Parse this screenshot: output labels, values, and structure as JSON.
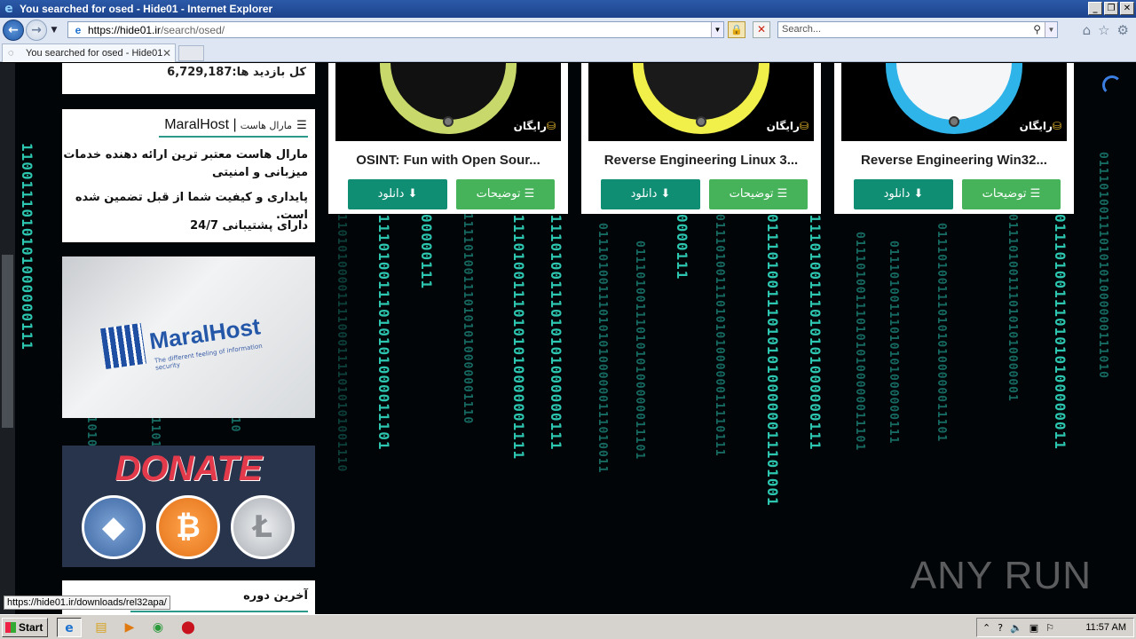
{
  "window": {
    "title": "You searched for osed - Hide01 - Internet Explorer",
    "minimize": "_",
    "restore": "❐",
    "close": "✕"
  },
  "addressbar": {
    "url_host": "https://hide01.ir",
    "url_path": "/search/osed/",
    "search_placeholder": "Search..."
  },
  "tabs": [
    {
      "label": "You searched for osed - Hide01"
    }
  ],
  "sidebar": {
    "visits": "کل بازدید ها:6,729,187",
    "host_box": {
      "title_en": "MaralHost |",
      "title_fa": "مارال هاست",
      "p1": "مارال هاست معتبر ترین ارائه دهنده خدمات میزبانی و امنیتی",
      "p2": "پایداری و کیفیت شما از قبل تضمین شده است.",
      "p3": "دارای پشتیبانی 24/7"
    },
    "ad_maralhost": {
      "brand": "MaralHost",
      "tagline": "The different feeling of information security"
    },
    "ad_donate": {
      "title": "DONATE"
    },
    "latest_title": "آخرین دوره"
  },
  "cards": [
    {
      "title": "OSINT: Fun with Open Sour...",
      "badge": "رایگان",
      "desc_button": "توضیحات",
      "download_button": "دانلود",
      "shield_color": "#c9d86a"
    },
    {
      "title": "Reverse Engineering Linux 3...",
      "badge": "رایگان",
      "desc_button": "توضیحات",
      "download_button": "دانلود",
      "shield_color": "#f1ef4a"
    },
    {
      "title": "Reverse Engineering Win32...",
      "badge": "رایگان",
      "desc_button": "توضیحات",
      "download_button": "دانلود",
      "shield_color": "#2fb4ea"
    }
  ],
  "statusbar": {
    "hover_url": "https://hide01.ir/downloads/rel32apa/"
  },
  "watermark": "ANY RUN",
  "taskbar": {
    "start": "Start",
    "clock": "11:57 AM"
  },
  "colors": {
    "accent_green": "#46b35a",
    "accent_teal": "#0f8e74",
    "matrix_text": "#2dc6b0"
  }
}
